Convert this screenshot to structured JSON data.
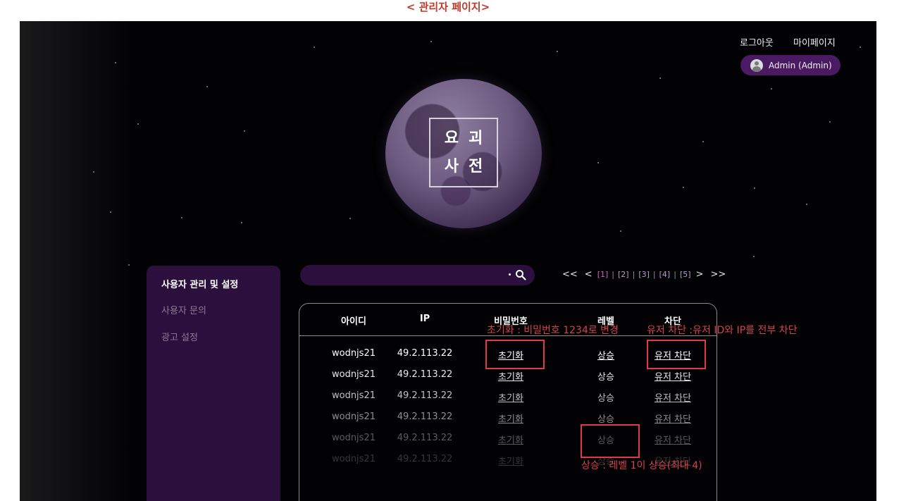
{
  "page_title": "< 관리자 페이지>",
  "header": {
    "logout_label": "로그아웃",
    "mypage_label": "마이페이지",
    "admin_badge": "Admin (Admin)"
  },
  "logo": {
    "line1": "요괴",
    "line2": "사전"
  },
  "sidebar": {
    "items": [
      {
        "label": "사용자 관리 및 설정",
        "active": true
      },
      {
        "label": "사용자 문의",
        "active": false
      },
      {
        "label": "광고 설정",
        "active": false
      }
    ]
  },
  "search": {
    "value": "",
    "placeholder": ""
  },
  "pagination": {
    "first": "<<",
    "prev": "<",
    "pages": [
      "[1]",
      "[2]",
      "[3]",
      "[4]",
      "[5]"
    ],
    "current": "[1]",
    "separator": "|",
    "next": ">",
    "last": ">>"
  },
  "table": {
    "headers": {
      "id": "아이디",
      "ip": "IP",
      "password": "비밀번호",
      "level": "레벨",
      "block": "차단"
    },
    "rows": [
      {
        "id": "wodnjs21",
        "ip": "49.2.113.22",
        "reset": "초기화",
        "level_up": "상승",
        "block": "유저 차단"
      },
      {
        "id": "wodnjs21",
        "ip": "49.2.113.22",
        "reset": "초기화",
        "level_up": "상승",
        "block": "유저 차단"
      },
      {
        "id": "wodnjs21",
        "ip": "49.2.113.22",
        "reset": "초기화",
        "level_up": "상승",
        "block": "유저 차단"
      },
      {
        "id": "wodnjs21",
        "ip": "49.2.113.22",
        "reset": "초기화",
        "level_up": "상승",
        "block": "유저 차단"
      },
      {
        "id": "wodnjs21",
        "ip": "49.2.113.22",
        "reset": "초기화",
        "level_up": "상승",
        "block": "유저 차단"
      },
      {
        "id": "wodnjs21",
        "ip": "49.2.113.22",
        "reset": "초기화",
        "level_up": "상승",
        "block": "유저 차단"
      }
    ],
    "row_opacity": [
      1.0,
      0.9,
      0.75,
      0.55,
      0.35,
      0.2
    ]
  },
  "annotations": {
    "reset": "초기화 : 비밀번호 1234로 변경",
    "block": "유저 차단 :유저 ID와 IP를 전부 차단",
    "level": "상승 : 레벨 1이 상승(최대 4)"
  },
  "colors": {
    "accent_purple": "#2b0f3d",
    "badge_purple": "#4a1a63",
    "current_page": "#d45fc0",
    "annotation_red": "#e0394a"
  }
}
